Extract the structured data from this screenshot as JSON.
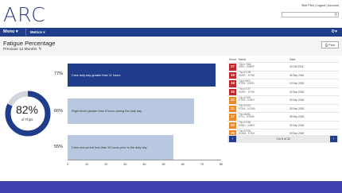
{
  "header": {
    "logo": "ARC",
    "user_line": "Bob Pilot | Logout | Account",
    "search_icon": "search-icon"
  },
  "nav": {
    "menu_label": "Menu ▾",
    "metric_label": "Metrics ▾",
    "gear_icon": "gear-icon"
  },
  "page": {
    "title": "Fatigue Percentage",
    "subtitle": "Previous 12 Months",
    "edit_icon": "pencil-icon",
    "print_label": "Print"
  },
  "gauge": {
    "value": "82%",
    "fraction": 0.82,
    "label": "of Trips",
    "color": "#1f3d8a",
    "track_color": "#d0d4dc"
  },
  "chart_data": {
    "type": "bar",
    "orientation": "horizontal",
    "categories": [
      "Crew duty day greater than 11 hours",
      "Flight times greater than 8 hours during the duty day",
      "Crew rest period less than 10 hours prior to the duty day"
    ],
    "values": [
      77,
      66,
      55
    ],
    "value_labels": [
      "77%",
      "66%",
      "55%"
    ],
    "colors": [
      "#1f3d8a",
      "#b7c8e0",
      "#b7c8e0"
    ],
    "xlim": [
      0,
      80
    ],
    "xticks": [
      "0",
      "10",
      "20",
      "30",
      "40",
      "50",
      "60",
      "70",
      "80"
    ]
  },
  "table": {
    "headers": [
      "Score",
      "Name",
      "Date"
    ],
    "rows": [
      {
        "score": "27",
        "color": "#c0282d",
        "trip": "Trip # 7582",
        "route": "KSDI - KMMF",
        "date": "30 Oct 2018"
      },
      {
        "score": "19",
        "color": "#c0282d",
        "trip": "Trip #7138",
        "route": "KMRY - KTNX",
        "date": "30 Sep 2018"
      },
      {
        "score": "18",
        "color": "#c0282d",
        "trip": "Trip# 6601",
        "route": "KTEB - KMRY",
        "date": "10 Sep 2018"
      },
      {
        "score": "15",
        "color": "#c0282d",
        "trip": "Trip #7187",
        "route": "KMRY - KTNX",
        "date": "30 Sep 2018"
      },
      {
        "score": "22",
        "color": "#e8892b",
        "trip": "Trip #7029",
        "route": "KTNX - KMRY",
        "date": "25 Sep 2018"
      },
      {
        "score": "21",
        "color": "#e8892b",
        "trip": "Trip #7032",
        "route": "KTNX - KOMA",
        "date": "30 Sep 2018"
      },
      {
        "score": "17",
        "color": "#e8892b",
        "trip": "Trip #6981",
        "route": "KTLL - KSDM",
        "date": "28 Sep 2018"
      },
      {
        "score": "20",
        "color": "#e8892b",
        "trip": "Trip #7166",
        "route": "KSBD - KMRY",
        "date": "30 Sep 2018"
      },
      {
        "score": "26",
        "color": "#e8892b",
        "trip": "Trip #7033",
        "route": "KOMA - KTNX",
        "date": "30 Sep 2018"
      }
    ]
  },
  "pager": {
    "text": "1 to 8 of 32",
    "prev_icon": "chevron-left-icon",
    "next_icon": "chevron-right-icon"
  }
}
